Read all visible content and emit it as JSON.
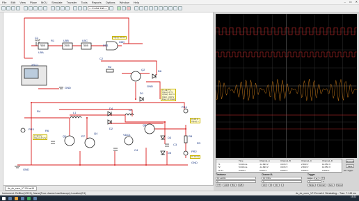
{
  "menu": {
    "items": [
      "File",
      "Edit",
      "View",
      "Place",
      "MCU",
      "Simulate",
      "Transfer",
      "Tools",
      "Reports",
      "Options",
      "Window",
      "Help"
    ],
    "window_controls": [
      "–",
      "▭",
      "✕"
    ]
  },
  "toolbar": {
    "in_use_list": "--- In-Use List ---"
  },
  "schematic": {
    "labels": {
      "c1": "C1",
      "c1v": "22µF",
      "u5a": "U5A",
      "u5a_part": "7805",
      "r1": "R1",
      "u5b": "U5B",
      "u5b_part": "7805",
      "u5c": "U5C",
      "u5c_part": "7805",
      "pr1": "PR1",
      "u6d": "U6D",
      "xsc1": "XSC1",
      "gnd": "GND",
      "c2": "C2",
      "r2": "R2",
      "q2": "Q2",
      "d6": "D6",
      "d1": "D1",
      "q3": "Q3",
      "r4": "R4",
      "l1": "L1",
      "l2": "L2",
      "d4": "D4",
      "d2": "D2",
      "d5": "D5",
      "vdc1": "VDC1",
      "pr3": "PR3",
      "pr4": "PR4",
      "pr2": "PR2",
      "r8": "R8",
      "r6": "R6",
      "q1": "Q1",
      "c4": "C4",
      "r7": "R7",
      "r3": "R3",
      "q4": "Q4",
      "d3": "D3",
      "c3": "C3",
      "gnd2": "GND",
      "gnd3": "GND",
      "gnd4": "GND"
    },
    "probe_texts": {
      "top": "V(p-p): 27.2 V",
      "mid": [
        "V: -12.7 V",
        "V(p-p): 27 V",
        "V(rms): 8.07 V",
        "V(dc): -3.03 V",
        "Freq: 17.6 kHz"
      ],
      "left": [
        "V: 32.3 V",
        "V(p-p): 27.2 V"
      ],
      "right": [
        "V: 2.5 V",
        "V(p-p): --"
      ],
      "bottom": [
        "V: 12.1 V"
      ]
    }
  },
  "tabs": {
    "active": "dc_dc_conv_V7.0V.ms14"
  },
  "scope": {
    "readout": {
      "headers": [
        "",
        "Time",
        "Channel_A",
        "Channel_B",
        "Channel_C",
        "Channel_D"
      ],
      "rows": [
        [
          "T1",
          "5.640 ms",
          "-11.823 V",
          "3.315 V",
          "2.503 V",
          "10.653 V"
        ],
        [
          "T2",
          "5.640 ms",
          "-11.823 V",
          "3.315 V",
          "2.503 V",
          "10.653 V"
        ],
        [
          "T2-T1",
          "0.000 s",
          "0.000 V",
          "0.000 V",
          "0.000 V",
          "0.000 V"
        ]
      ]
    },
    "buttons": [
      "Reverse",
      "Save"
    ],
    "ext_trigger": "Ext. trigger",
    "timebase": {
      "title": "Timebase",
      "scale": "10 µs/Div",
      "xpos": "0",
      "modes": [
        "Y/T",
        "Add",
        "B/A",
        "A/B"
      ]
    },
    "channel": {
      "title": "Channel A",
      "scale": "10 V/Div",
      "ypos": "0",
      "modes": [
        "AC",
        "0",
        "DC",
        "-"
      ]
    },
    "trigger": {
      "title": "Trigger",
      "edge": "Edge:",
      "level": "0",
      "unit": "V",
      "modes": [
        "Single",
        "Normal",
        "Auto",
        "None"
      ]
    }
  },
  "status": {
    "left": "Instrument: Reffline(XSC1), Name(Four channel oscilloscope) Location(2.5)",
    "right": "dc_dc_conv_V7.0V.ms14: Simulating... Tran: 7.145 ms"
  },
  "taskbar": {
    "time": "15:22"
  },
  "colors": {
    "wire": "#d81b1b",
    "trace_a": "#d83030",
    "trace_c": "#c87a1a",
    "screen_grid": "#3a3a3a"
  }
}
